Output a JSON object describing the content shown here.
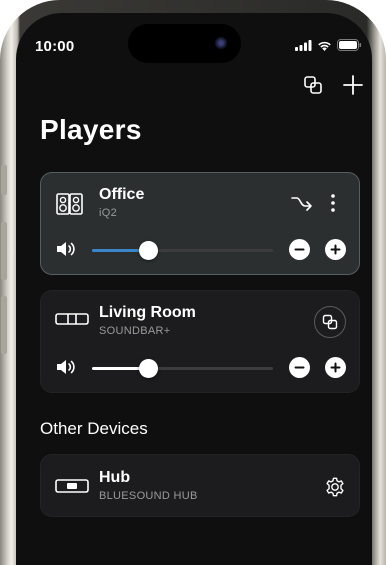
{
  "status_bar": {
    "time": "10:00"
  },
  "header": {
    "title": "Players"
  },
  "players": [
    {
      "name": "Office",
      "model": "iQ2",
      "selected": true,
      "volume": 0.31,
      "fill_color": "#3b86c8"
    },
    {
      "name": "Living Room",
      "model": "SOUNDBAR+",
      "selected": false,
      "volume": 0.31,
      "fill_color": "#ffffff"
    }
  ],
  "other_devices": {
    "title": "Other Devices",
    "items": [
      {
        "name": "Hub",
        "model": "BLUESOUND HUB"
      }
    ]
  },
  "icons": {
    "group": "group-icon",
    "add": "plus-icon",
    "shuffle": "shuffle-icon",
    "more": "more-vertical-icon",
    "volume": "speaker-icon",
    "minus": "minus-icon",
    "plus": "plus-icon",
    "settings": "gear-icon"
  }
}
